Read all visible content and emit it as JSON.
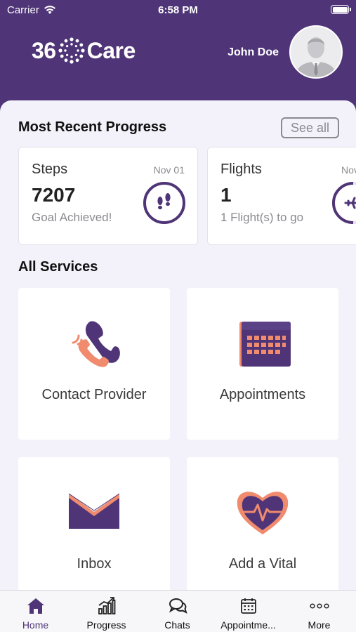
{
  "status_bar": {
    "carrier": "Carrier",
    "time": "6:58 PM"
  },
  "header": {
    "logo_prefix": "36",
    "logo_suffix": "Care",
    "user_name": "John Doe"
  },
  "progress": {
    "title": "Most Recent Progress",
    "see_all": "See all",
    "cards": [
      {
        "title": "Steps",
        "date": "Nov 01",
        "value": "7207",
        "subtitle": "Goal Achieved!",
        "icon": "footsteps-icon",
        "progress": 1.0
      },
      {
        "title": "Flights",
        "date": "Nov",
        "value": "1",
        "subtitle": "1 Flight(s) to go",
        "icon": "airplane-icon",
        "progress": 0.5
      }
    ]
  },
  "services": {
    "title": "All Services",
    "items": [
      {
        "label": "Contact Provider",
        "icon": "phone-icon"
      },
      {
        "label": "Appointments",
        "icon": "calendar-icon"
      },
      {
        "label": "Inbox",
        "icon": "envelope-icon"
      },
      {
        "label": "Add a Vital",
        "icon": "heart-pulse-icon"
      }
    ]
  },
  "tabbar": {
    "tabs": [
      {
        "label": "Home",
        "icon": "home-icon",
        "active": true
      },
      {
        "label": "Progress",
        "icon": "chart-icon",
        "active": false
      },
      {
        "label": "Chats",
        "icon": "chat-icon",
        "active": false
      },
      {
        "label": "Appointme...",
        "icon": "calendar-icon",
        "active": false
      },
      {
        "label": "More",
        "icon": "more-icon",
        "active": false
      }
    ]
  },
  "colors": {
    "brand_purple": "#4f3577",
    "accent_coral": "#f08b6e",
    "background": "#f3f2fa"
  }
}
